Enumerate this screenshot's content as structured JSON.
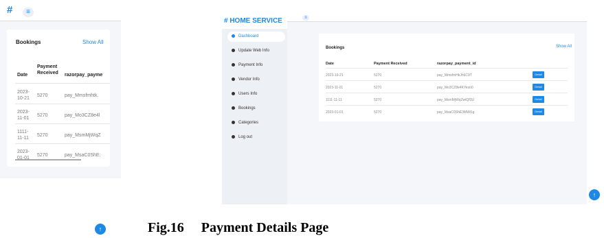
{
  "mobile": {
    "brand_symbol": "#",
    "menu_icon": "≡",
    "card_title": "Bookings",
    "show_all": "Show All",
    "headers": [
      "Date",
      "Payment Received",
      "razorpay_payme"
    ],
    "rows": [
      {
        "date": "2023-10-21",
        "amount": "5270",
        "id": "pay_Mmsfmhtk."
      },
      {
        "date": "2023-11-01",
        "amount": "5270",
        "id": "pay_Mo3CZ8e4l"
      },
      {
        "date": "1111-11-11",
        "amount": "5270",
        "id": "pay_MsmMjWqZ"
      },
      {
        "date": "2023-01-01",
        "amount": "5270",
        "id": "pay_MsaC0ShE:"
      }
    ]
  },
  "desktop": {
    "brand": "# HOME SERVICE",
    "menu_icon": "≡",
    "sidebar": [
      {
        "label": "Dashboard",
        "active": true
      },
      {
        "label": "Update Web Info",
        "active": false
      },
      {
        "label": "Payment Info",
        "active": false
      },
      {
        "label": "Vendor Info",
        "active": false
      },
      {
        "label": "Users Info",
        "active": false
      },
      {
        "label": "Bookings",
        "active": false
      },
      {
        "label": "Categories",
        "active": false
      },
      {
        "label": "Log out",
        "active": false
      }
    ],
    "card_title": "Bookings",
    "show_all": "Show All",
    "headers": [
      "Date",
      "Payment Received",
      "razorpay_payment_id"
    ],
    "rows": [
      {
        "date": "2023-10-21",
        "amount": "5270",
        "id": "pay_MmsfmHkJh6C9T",
        "action": "Detail"
      },
      {
        "date": "2023-11-01",
        "amount": "5270",
        "id": "pay_Mo3CZ8e4KYeso0",
        "action": "Detail"
      },
      {
        "date": "1111-11-11",
        "amount": "5270",
        "id": "pay_MsmMjWqZwtQf3U",
        "action": "Detail"
      },
      {
        "date": "2023-01-01",
        "amount": "5270",
        "id": "pay_MsaC0ShE3MWi1g",
        "action": "Detail"
      }
    ]
  },
  "scroll_top_icon": "↑",
  "caption": "Fig.16     Payment Details Page",
  "colors": {
    "accent": "#1e88e5",
    "panel_bg": "#f4f6f9",
    "sidebar_bg": "#edf0f4"
  }
}
